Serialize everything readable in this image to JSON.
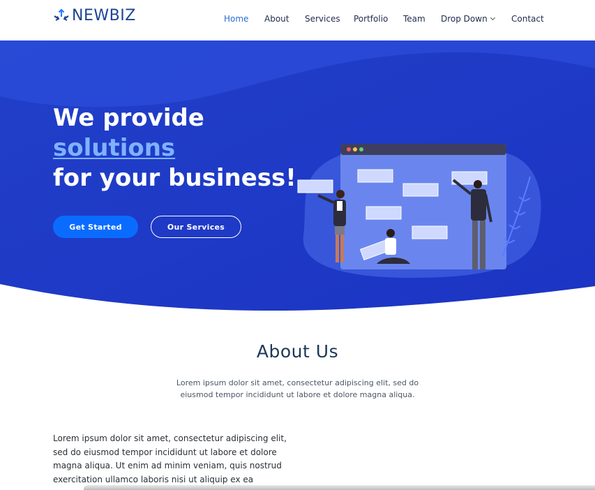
{
  "brand": {
    "name": "NEWBIZ",
    "colors": {
      "primary": "#1b4492",
      "accent": "#0a6cff",
      "hero_bg": "#1f3ed1",
      "highlight": "#7fb2ff"
    }
  },
  "nav": {
    "items": [
      {
        "label": "Home",
        "active": true
      },
      {
        "label": "About"
      },
      {
        "label": "Services"
      },
      {
        "label": "Portfolio"
      },
      {
        "label": "Team"
      },
      {
        "label": "Drop Down",
        "icon": "chevron-down-icon"
      },
      {
        "label": "Contact"
      }
    ]
  },
  "hero": {
    "line1": "We provide",
    "line2": "solutions",
    "line3": "for your business!",
    "primary_button": "Get Started",
    "secondary_button": "Our Services"
  },
  "about": {
    "title": "About Us",
    "subtitle": "Lorem ipsum dolor sit amet, consectetur adipiscing elit, sed do eiusmod tempor incididunt ut labore et dolore magna aliqua.",
    "body": "Lorem ipsum dolor sit amet, consectetur adipiscing elit, sed do eiusmod tempor incididunt ut labore et dolore magna aliqua. Ut enim ad minim veniam, quis nostrud exercitation ullamco laboris nisi ut aliquip ex ea commodo consequat."
  }
}
